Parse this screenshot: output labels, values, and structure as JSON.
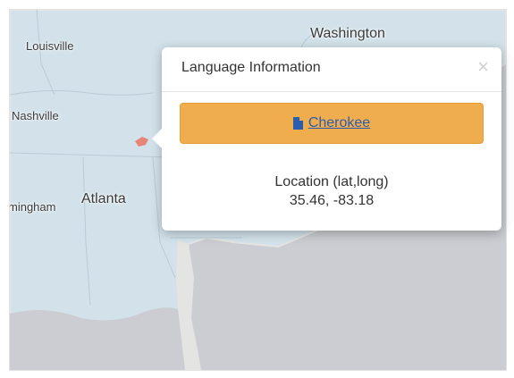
{
  "map": {
    "cities": [
      {
        "id": "louisville",
        "name": "Louisville"
      },
      {
        "id": "washington",
        "name": "Washington"
      },
      {
        "id": "nashville",
        "name": "Nashville"
      },
      {
        "id": "birmingham",
        "name": "mingham"
      },
      {
        "id": "atlanta",
        "name": "Atlanta"
      }
    ],
    "colors": {
      "land": "#d3e2ea",
      "water": "#cbcdd2",
      "coast": "#e4e5e2",
      "marker": "#e8857a"
    }
  },
  "popup": {
    "title": "Language Information",
    "close_symbol": "×",
    "language_button": {
      "label": "Cherokee",
      "icon": "file-icon",
      "color": "#f0ad4e"
    },
    "location_label": "Location (lat,long)",
    "location_value": "35.46, -83.18"
  }
}
